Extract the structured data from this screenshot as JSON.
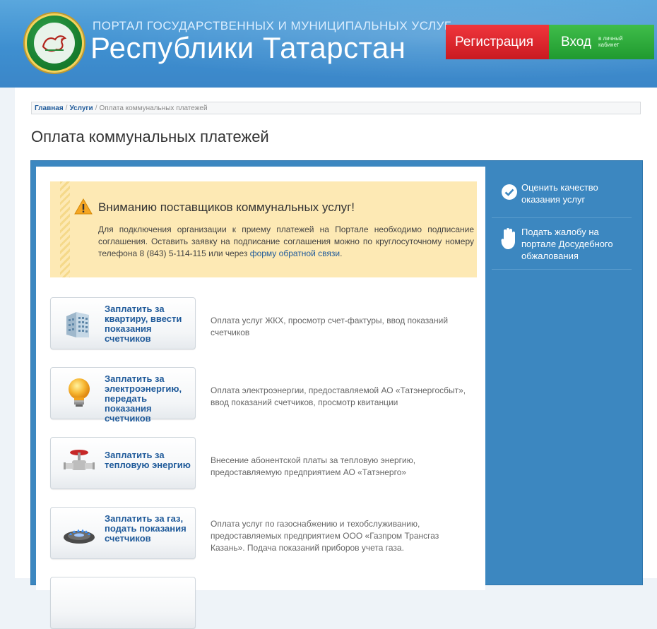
{
  "header": {
    "subtitle": "ПОРТАЛ ГОСУДАРСТВЕННЫХ И МУНИЦИПАЛЬНЫХ УСЛУГ",
    "title": "Республики Татарстан",
    "register_label": "Регистрация",
    "login_label": "Вход",
    "login_sub": "в личный кабинет"
  },
  "breadcrumb": {
    "home": "Главная",
    "services": "Услуги",
    "current": "Оплата коммунальных платежей"
  },
  "page_title": "Оплата коммунальных платежей",
  "warning": {
    "title": "Вниманию поставщиков коммунальных услуг!",
    "text": "Для подключения организации к приему платежей на Портале необходимо подписание соглашения. Оставить заявку на подписание соглашения можно по круглосуточному номеру телефона 8 (843) 5-114-115 или через ",
    "link": "форму обратной связи",
    "tail": "."
  },
  "services": [
    {
      "label": "Заплатить за квартиру, ввести показания счетчиков",
      "desc": "Оплата услуг ЖКХ, просмотр счет-фактуры, ввод показаний счетчиков",
      "icon": "building-icon"
    },
    {
      "label": "Заплатить за электроэнергию, передать показания счетчиков",
      "desc": "Оплата электроэнергии, предоставляемой АО «Татэнергосбыт», ввод показаний счетчиков, просмотр квитанции",
      "icon": "lightbulb-icon"
    },
    {
      "label": "Заплатить за тепловую энергию",
      "desc": "Внесение абонентской платы за тепловую энергию, предоставляемую предприятием АО «Татэнерго»",
      "icon": "valve-icon"
    },
    {
      "label": "Заплатить за газ, подать показания счетчиков",
      "desc": "Оплата услуг по газоснабжению и техобслуживанию, предоставляемых предприятием ООО «Газпром Трансгаз Казань». Подача показаний приборов учета газа.",
      "icon": "gas-burner-icon"
    }
  ],
  "sidebar": {
    "items": [
      {
        "label": "Оценить качество оказания услуг",
        "icon": "check-circle-icon"
      },
      {
        "label": "Подать жалобу на портале Досудебного обжалования",
        "icon": "hand-icon"
      }
    ]
  },
  "colors": {
    "brand_blue": "#3c87c0",
    "register_red": "#e0262d",
    "login_green": "#2eaa3b",
    "warning_bg": "#fde9b4",
    "link_blue": "#1f5a9a"
  }
}
